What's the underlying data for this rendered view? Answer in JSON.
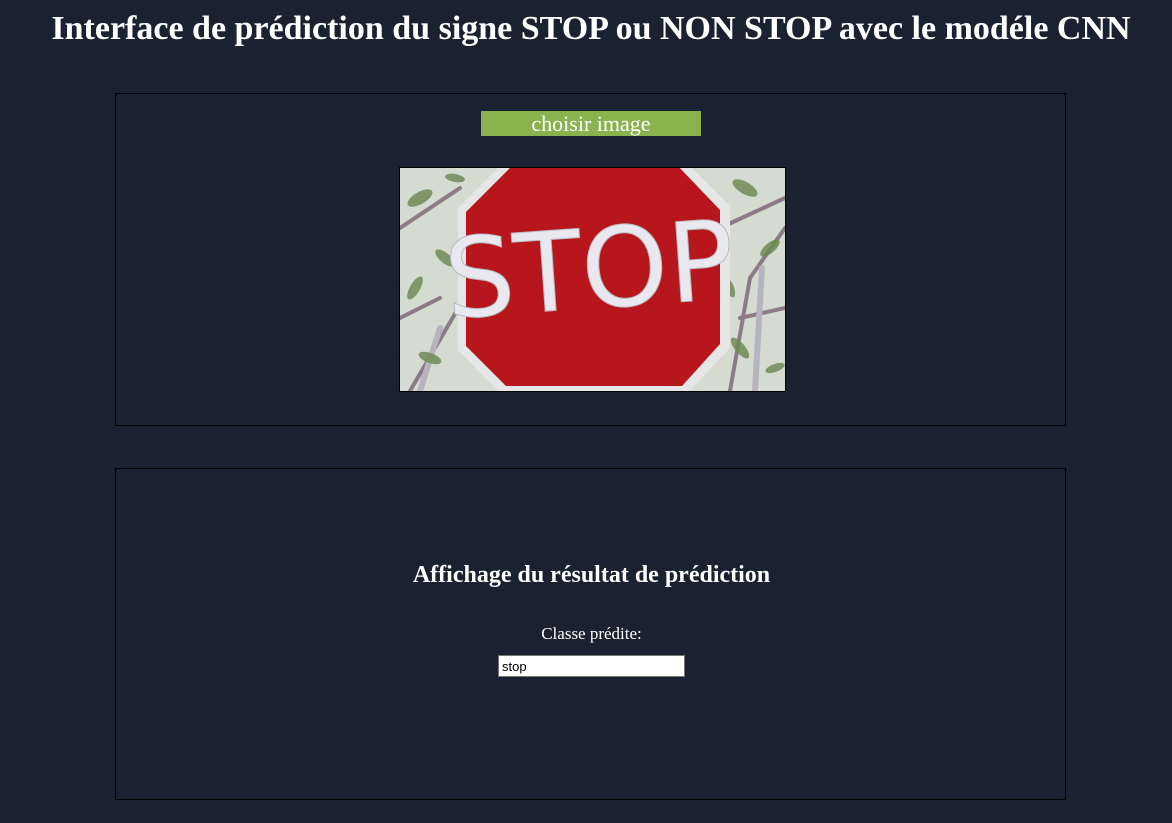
{
  "header": {
    "title": "Interface de prédiction du signe STOP ou NON STOP avec le modéle CNN"
  },
  "upload": {
    "button_label": "choisir image",
    "image_sign_text": "STOP"
  },
  "result": {
    "heading": "Affichage du résultat de prédiction",
    "class_label": "Classe prédite:",
    "predicted_class": "stop"
  },
  "colors": {
    "background": "#1a2231",
    "button": "#8ab34f",
    "sign_red": "#c41a1f"
  }
}
